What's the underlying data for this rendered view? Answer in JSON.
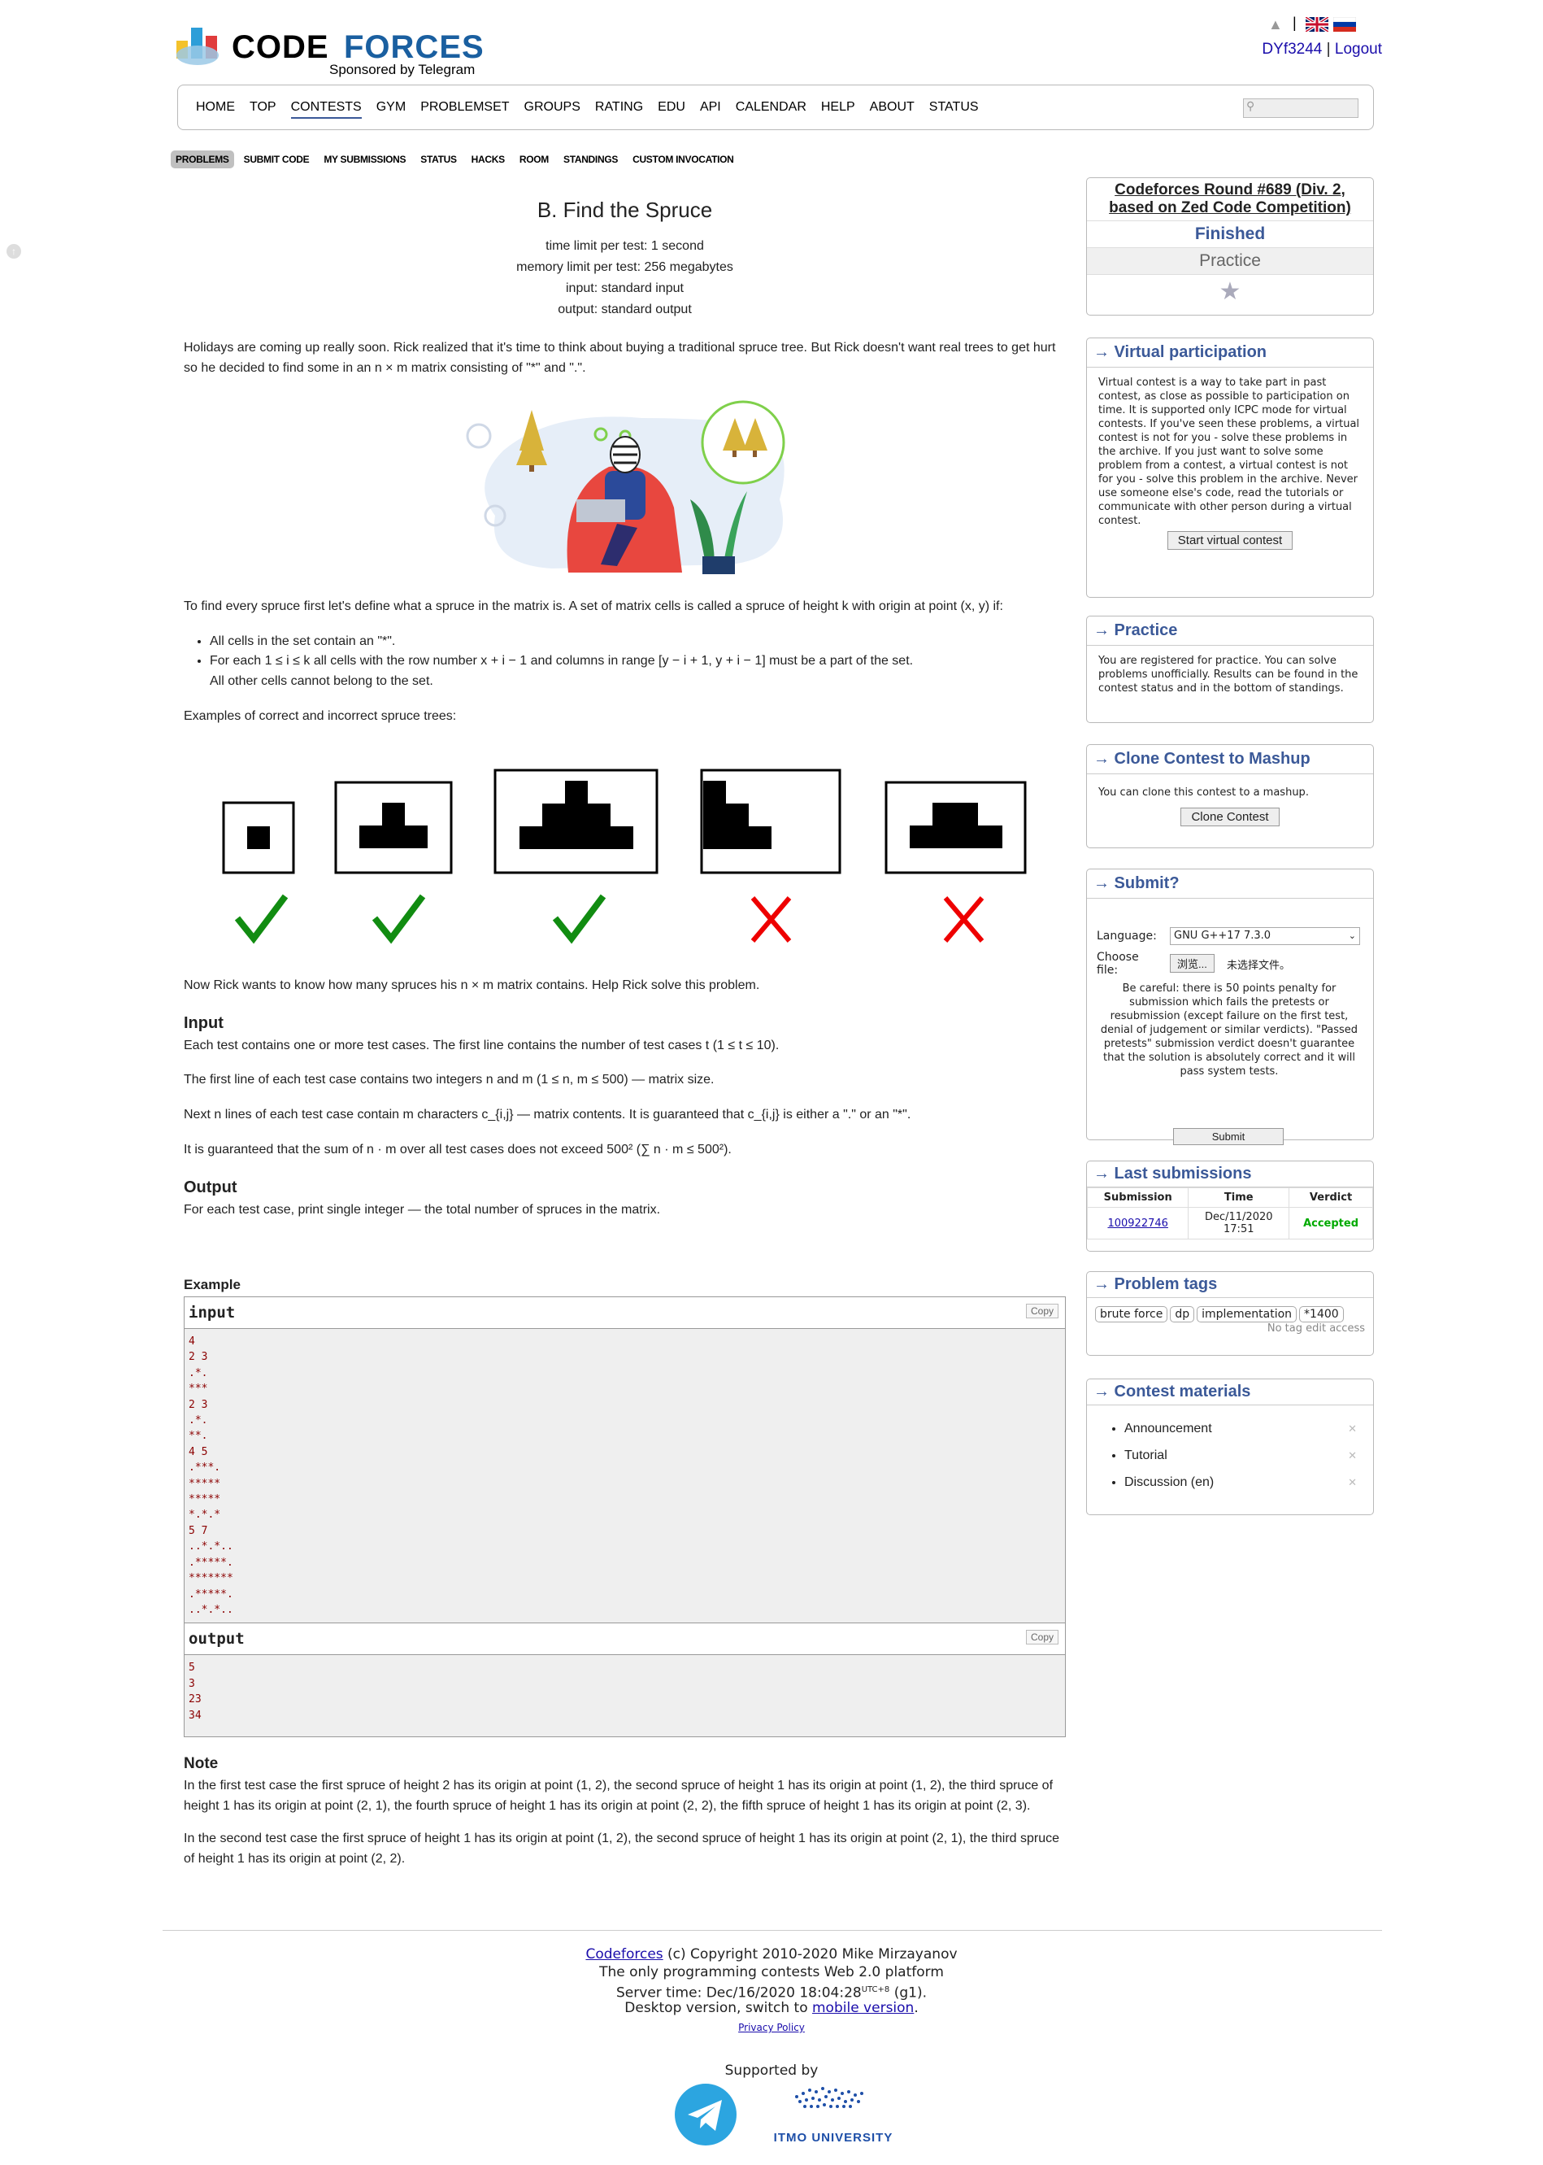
{
  "header": {
    "logo_code": "CODE",
    "logo_forces": "FORCES",
    "sponsor": "Sponsored by Telegram",
    "user": "DYf3244",
    "sep": "|",
    "logout": "Logout"
  },
  "nav": {
    "items": [
      "HOME",
      "TOP",
      "CONTESTS",
      "GYM",
      "PROBLEMSET",
      "GROUPS",
      "RATING",
      "EDU",
      "API",
      "CALENDAR",
      "HELP",
      "ABOUT",
      "STATUS"
    ],
    "active_index": 2
  },
  "subnav": {
    "items": [
      "PROBLEMS",
      "SUBMIT CODE",
      "MY SUBMISSIONS",
      "STATUS",
      "HACKS",
      "ROOM",
      "STANDINGS",
      "CUSTOM INVOCATION"
    ],
    "active_index": 0
  },
  "problem": {
    "title": "B. Find the Spruce",
    "time_limit": "time limit per test: 1 second",
    "memory_limit": "memory limit per test: 256 megabytes",
    "input": "input: standard input",
    "output": "output: standard output",
    "intro": "Holidays are coming up really soon. Rick realized that it's time to think about buying a traditional spruce tree. But Rick doesn't want real trees to get hurt so he decided to find some in an n × m matrix consisting of \"*\" and \".\".",
    "def": "To find every spruce first let's define what a spruce in the matrix is. A set of matrix cells is called a spruce of height k with origin at point (x, y) if:",
    "bullet1": "All cells in the set contain an \"*\".",
    "bullet2a": "For each 1 ≤ i ≤ k all cells with the row number x + i − 1 and columns in range [y − i + 1, y + i − 1] must be a part of the set.",
    "bullet2b": "All other cells cannot belong to the set.",
    "examples_text": "Examples of correct and incorrect spruce trees:",
    "now_text": "Now Rick wants to know how many spruces his n × m matrix contains. Help Rick solve this problem.",
    "input_title": "Input",
    "input_p1": "Each test contains one or more test cases. The first line contains the number of test cases t (1 ≤ t ≤ 10).",
    "input_p2": "The first line of each test case contains two integers n and m (1 ≤ n, m ≤ 500) — matrix size.",
    "input_p3": "Next n lines of each test case contain m characters c_{i,j} — matrix contents. It is guaranteed that c_{i,j} is either a \".\" or an \"*\".",
    "input_p4": "It is guaranteed that the sum of n · m over all test cases does not exceed 500² (∑ n · m ≤ 500²).",
    "output_title": "Output",
    "output_p": "For each test case, print single integer — the total number of spruces in the matrix.",
    "example_title": "Example",
    "input_label": "input",
    "output_label": "output",
    "copy": "Copy",
    "sample_input": "4\n2 3\n.*.\n***\n2 3\n.*.\n**.\n4 5\n.***.\n*****\n*****\n*.*.*\n5 7\n..*.*..\n.*****.\n*******\n.*****.\n..*.*..",
    "sample_output": "5\n3\n23\n34",
    "note_title": "Note",
    "note_p1": "In the first test case the first spruce of height 2 has its origin at point (1, 2), the second spruce of height 1 has its origin at point (1, 2), the third spruce of height 1 has its origin at point (2, 1), the fourth spruce of height 1 has its origin at point (2, 2), the fifth spruce of height 1 has its origin at point (2, 3).",
    "note_p2": "In the second test case the first spruce of height 1 has its origin at point (1, 2), the second spruce of height 1 has its origin at point (2, 1), the third spruce of height 1 has its origin at point (2, 2)."
  },
  "sidebar": {
    "round_name": "Codeforces Round #689 (Div. 2, based on Zed Code Competition)",
    "round_status": "Finished",
    "round_practice": "Practice",
    "virtual_title": "→ Virtual participation",
    "virtual_text": "Virtual contest is a way to take part in past contest, as close as possible to participation on time. It is supported only ICPC mode for virtual contests. If you've seen these problems, a virtual contest is not for you - solve these problems in the archive. If you just want to solve some problem from a contest, a virtual contest is not for you - solve this problem in the archive. Never use someone else's code, read the tutorials or communicate with other person during a virtual contest.",
    "virtual_button": "Start virtual contest",
    "practice_title": "→ Practice",
    "practice_text": "You are registered for practice. You can solve problems unofficially. Results can be found in the contest status and in the bottom of standings.",
    "clone_title": "→ Clone Contest to Mashup",
    "clone_text": "You can clone this contest to a mashup.",
    "clone_button": "Clone Contest",
    "submit_title": "→ Submit?",
    "language_label": "Language:",
    "language_value": "GNU G++17 7.3.0",
    "file_label": "Choose file:",
    "file_button": "浏览...",
    "file_status": "未选择文件。",
    "submit_warning": "Be careful: there is 50 points penalty for submission which fails the pretests or resubmission (except failure on the first test, denial of judgement or similar verdicts). \"Passed pretests\" submission verdict doesn't guarantee that the solution is absolutely correct and it will pass system tests.",
    "submit_button": "Submit",
    "last_title": "→ Last submissions",
    "last_headers": [
      "Submission",
      "Time",
      "Verdict"
    ],
    "last_rows": [
      {
        "id": "100922746",
        "time_line1": "Dec/11/2020",
        "time_line2": "17:51",
        "verdict": "Accepted"
      }
    ],
    "tags_title": "→ Problem tags",
    "tags": [
      "brute force",
      "dp",
      "implementation",
      "*1400"
    ],
    "tags_note": "No tag edit access",
    "materials_title": "→ Contest materials",
    "materials": [
      "Announcement",
      "Tutorial",
      "Discussion (en)"
    ]
  },
  "footer": {
    "cf_link": "Codeforces",
    "copyright": "(c) Copyright 2010-2020 Mike Mirzayanov",
    "line2": "The only programming contests Web 2.0 platform",
    "server_time": "Server time: Dec/16/2020 18:04:28",
    "utc": "UTC+8",
    "g1": "(g1).",
    "line4a": "Desktop version, switch to",
    "mobile_link": "mobile version",
    "privacy": "Privacy Policy",
    "supported_by": "Supported by",
    "itmo": "ITMO UNIVERSITY"
  },
  "colors": {
    "link_blue": "#3b5998",
    "accepted": "#0a0",
    "red_x": "#e00",
    "green_check": "#118c11",
    "sample_text": "#8b0000"
  }
}
